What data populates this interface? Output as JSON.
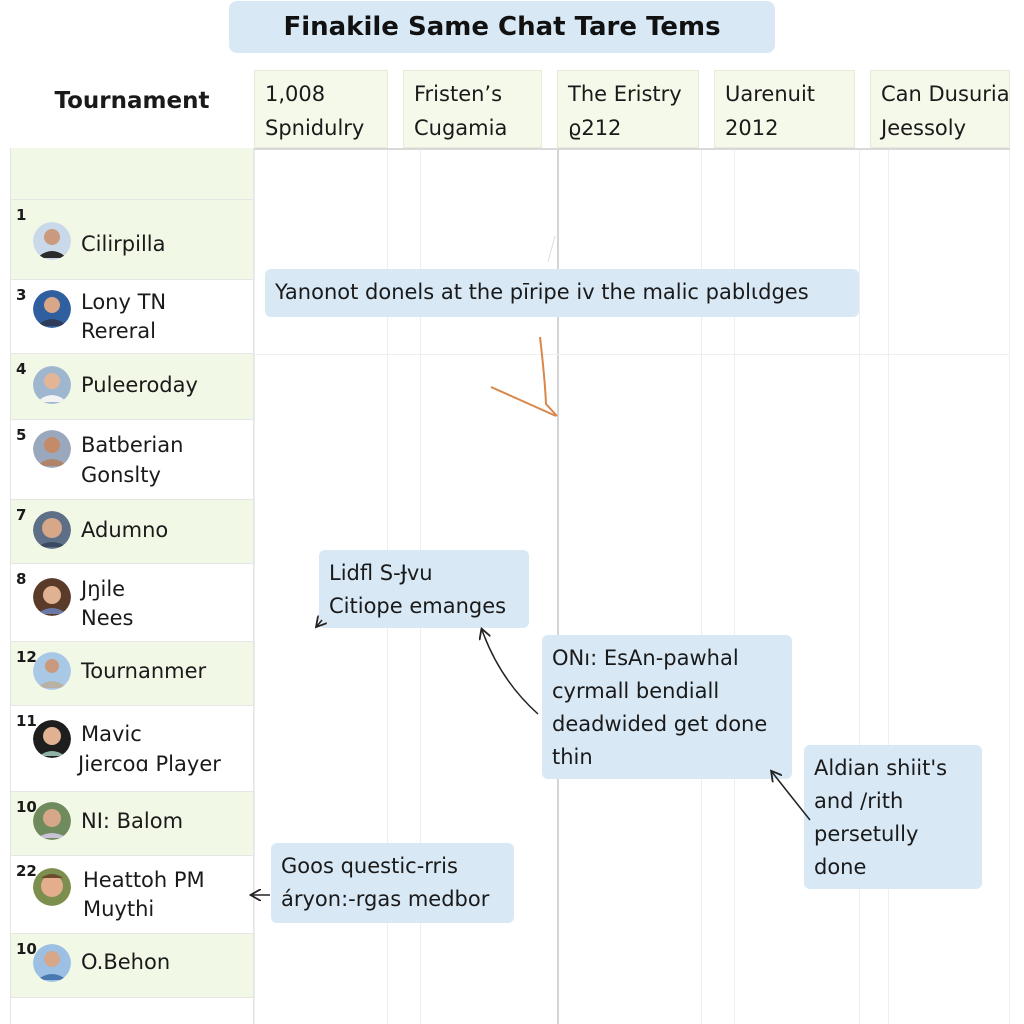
{
  "title": "Finakile Same Chat Tare Tems",
  "corner_label": "Tournament",
  "columns": [
    {
      "line1": "1,008",
      "line2": "Spnidulry"
    },
    {
      "line1": "Fristen’s",
      "line2": "Cugamia"
    },
    {
      "line1": "The Eristry",
      "line2": "ϱ212"
    },
    {
      "line1": "Uarenuit",
      "line2": "2012"
    },
    {
      "line1": "Can Dusuriac",
      "line2": "Jeessoly"
    }
  ],
  "players": [
    {
      "rank": "",
      "name1": "",
      "name2": ""
    },
    {
      "rank": "1",
      "name1": "Cilirpilla",
      "name2": "",
      "avatar": "avatar-icon",
      "tone": "#8aa6c8"
    },
    {
      "rank": "3",
      "name1": "Lony TN",
      "name2": "Rereral",
      "avatar": "avatar-icon",
      "tone": "#2f5f9e"
    },
    {
      "rank": "4",
      "name1": "Puleeroday",
      "name2": "",
      "avatar": "avatar-icon",
      "tone": "#9fb6cf"
    },
    {
      "rank": "5",
      "name1": "Batberian",
      "name2": "Gonslty",
      "avatar": "avatar-icon",
      "tone": "#9aa8bd"
    },
    {
      "rank": "7",
      "name1": "Adumno",
      "name2": "",
      "avatar": "avatar-icon",
      "tone": "#5d6f86"
    },
    {
      "rank": "8",
      "name1": "Jŋile",
      "name2": "Nees",
      "avatar": "avatar-icon",
      "tone": "#7a5a45"
    },
    {
      "rank": "12",
      "name1": "Tournanmer",
      "name2": "",
      "avatar": "avatar-icon",
      "tone": "#a9c8e6"
    },
    {
      "rank": "11",
      "name1": "Mavic",
      "name2": "Jiercoɑ Player",
      "avatar": "avatar-icon",
      "tone": "#2a2a2a"
    },
    {
      "rank": "10",
      "name1": "NI: Balom",
      "name2": "",
      "avatar": "avatar-icon",
      "tone": "#6f8a5c"
    },
    {
      "rank": "22",
      "name1": "Heattoh PM",
      "name2": "Muythi",
      "avatar": "avatar-icon",
      "tone": "#7d8f4e"
    },
    {
      "rank": "10",
      "name1": "O.Behon",
      "name2": "",
      "avatar": "avatar-icon",
      "tone": "#9cc0e4"
    }
  ],
  "notes": [
    {
      "lines": [
        "Yanonot donels at the pīripe iv the malic pablɩdges"
      ]
    },
    {
      "lines": [
        "Lidfl S-Ɉvu",
        "Citiope emanges"
      ]
    },
    {
      "lines": [
        "ONı: EsAn-pawhal",
        "cyrmall bendiall",
        "deadwided get done",
        "thin"
      ]
    },
    {
      "lines": [
        "Aldian shiit's",
        "and /rith",
        "persetully",
        "done"
      ]
    },
    {
      "lines": [
        "Goos questic-rris",
        "áryon:-rgas medbor"
      ]
    }
  ],
  "colors": {
    "note_bg": "#d8e8f5",
    "row_alt": "#f2f8e6",
    "header_bg": "#f5f9ea",
    "arrow_orange": "#d9874a",
    "arrow_dark": "#222222"
  }
}
